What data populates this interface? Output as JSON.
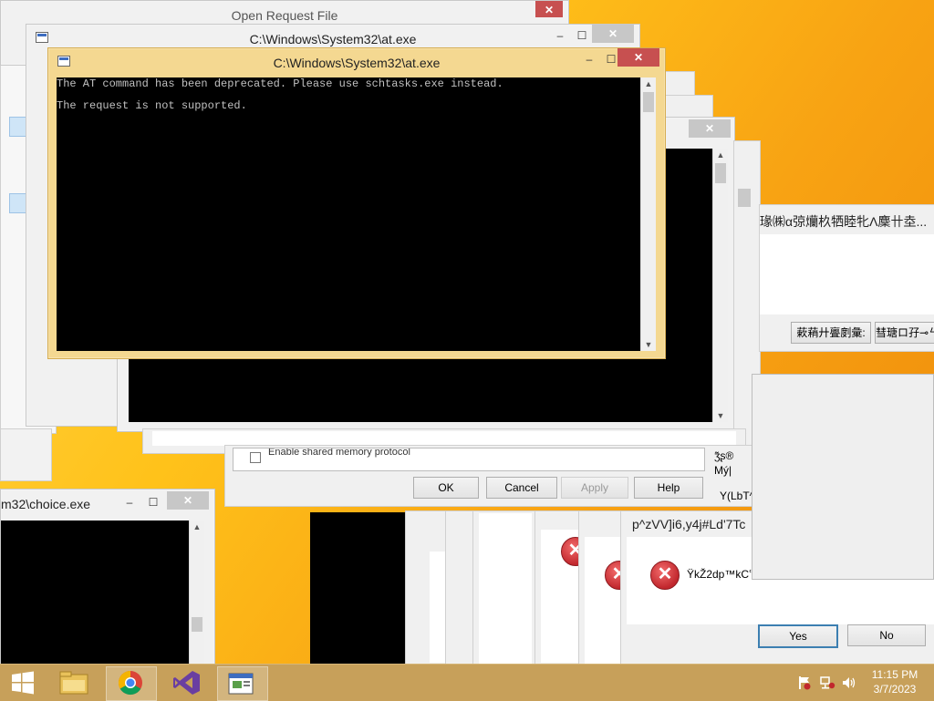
{
  "windows": {
    "open_request": {
      "title": "Open Request File"
    },
    "at_back": {
      "title": "C:\\Windows\\System32\\at.exe"
    },
    "at_front": {
      "title": "C:\\Windows\\System32\\at.exe",
      "lines": [
        "The AT command has been deprecated. Please use schtasks.exe instead.",
        "The request is not supported."
      ]
    },
    "choice": {
      "title": "m32\\choice.exe"
    },
    "garbled_dialog": {
      "title": "瑑㈱α弶爤杦牺睦牝Λ麇卄坴...",
      "button1": "蔌蕱廾亹剫彙:",
      "button2": "彗瑭ロ孖⊸ㄣ"
    },
    "properties": {
      "checkbox_label": "Enable shared memory protocol",
      "side_text1": "ʒ͂ʂ®",
      "side_text2": "Mý|",
      "side_text3": "Y(LbT^",
      "ok": "OK",
      "cancel": "Cancel",
      "apply": "Apply",
      "help": "Help"
    },
    "error_dialog": {
      "title": "p^zVV]i6,y4j#Ld'7Tc",
      "message": "ŸkŽ2dp™kCՙ",
      "yes": "Yes",
      "no": "No"
    }
  },
  "tray": {
    "time": "11:15 PM",
    "date": "3/7/2023"
  },
  "icons": {
    "minimize": "‒",
    "maximize": "☐",
    "close": "✕",
    "error": "✕",
    "scroll_up": "▲",
    "scroll_down": "▼",
    "start": "windows-logo"
  },
  "colors": {
    "desktop": "#ffc21a",
    "active_frame": "#f4d891",
    "close_button": "#c75050",
    "taskbar": "#c7a05a"
  }
}
